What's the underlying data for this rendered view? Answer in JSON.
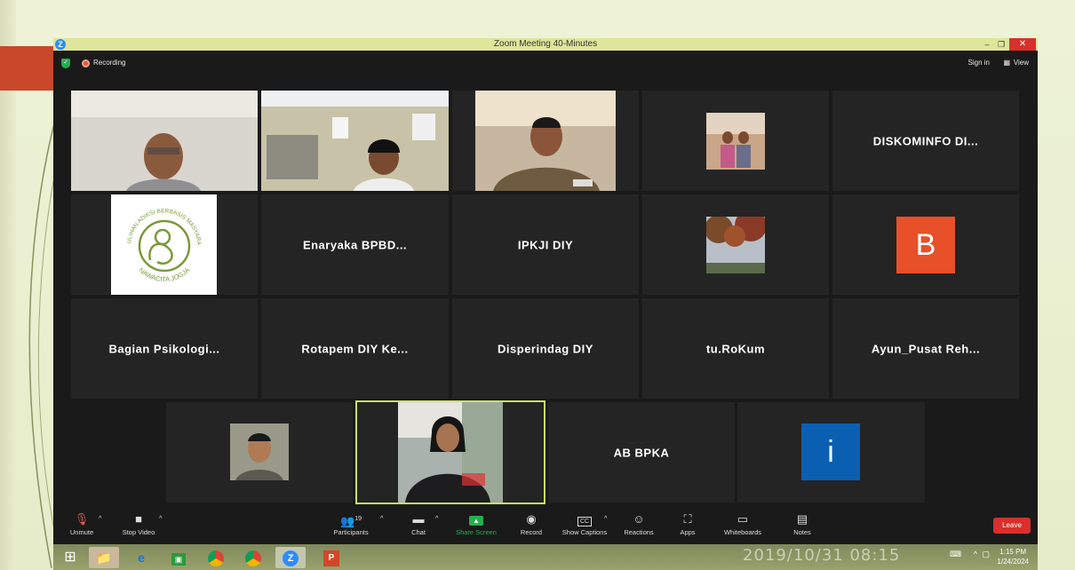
{
  "window": {
    "title": "Zoom Meeting 40-Minutes"
  },
  "topbar": {
    "recording_label": "Recording",
    "signin_label": "Sign in",
    "view_label": "View"
  },
  "tiles": [
    {
      "name": "DISKOMINFO  DI..."
    },
    {
      "name": "Enaryaka  BPBD..."
    },
    {
      "name": "IPKJI DIY"
    },
    {
      "name": "Bagian  Psikologi..."
    },
    {
      "name": "Rotapem  DIY  Ke..."
    },
    {
      "name": "Disperindag DIY"
    },
    {
      "name": "tu.RoKum"
    },
    {
      "name": "Ayun_Pusat  Reh..."
    },
    {
      "name": "AB BPKA"
    }
  ],
  "avatars": {
    "b": "B",
    "i": "i"
  },
  "logo": {
    "arc_text": "PEMULIHAN ADIKSI BERBASIS MASYARAKAT",
    "bottom_text": "NAWACITA JOGJA"
  },
  "toolbar": {
    "unmute": "Unmute",
    "stop_video": "Stop Video",
    "participants": "Participants",
    "participants_count": "19",
    "chat": "Chat",
    "share_screen": "Share Screen",
    "record": "Record",
    "show_captions": "Show Captions",
    "reactions": "Reactions",
    "apps": "Apps",
    "whiteboards": "Whiteboards",
    "notes": "Notes",
    "leave": "Leave"
  },
  "taskbar": {
    "timestamp": "2019/10/31  08:15",
    "time": "1:15 PM",
    "date": "1/24/2024"
  },
  "colors": {
    "accent_green": "#23b14d",
    "leave_red": "#d9302c",
    "speaker_border": "#c8e26a",
    "avatar_b": "#e8502a",
    "avatar_i": "#0b5fb3"
  }
}
